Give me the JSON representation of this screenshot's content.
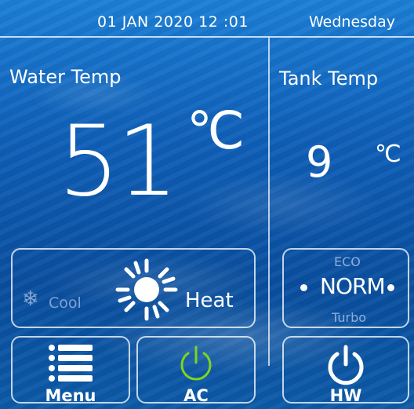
{
  "status_bar": {
    "datetime": "01 JAN 2020 12 :01",
    "weekday": "Wednesday"
  },
  "water": {
    "label": "Water Temp",
    "value": "51",
    "unit": "℃"
  },
  "tank": {
    "label": "Tank Temp",
    "value": "9",
    "unit": "℃"
  },
  "mode": {
    "cool_label": "Cool",
    "heat_label": "Heat",
    "selected": "Heat",
    "cool_icon": "snowflake-icon",
    "heat_icon": "sun-icon"
  },
  "power_mode": {
    "eco_label": "ECO",
    "norm_label": "NORM",
    "turbo_label": "Turbo",
    "selected": "NORM"
  },
  "buttons": {
    "menu_label": "Menu",
    "ac_label": "AC",
    "hw_label": "HW",
    "menu_icon": "list-icon",
    "ac_icon": "power-icon",
    "hw_icon": "power-icon",
    "ac_power_color": "#7ed321",
    "hw_power_color": "#ffffff"
  },
  "colors": {
    "text": "#ffffff",
    "inactive_text": "#c8d6f0",
    "background": "#0f5fb8"
  }
}
